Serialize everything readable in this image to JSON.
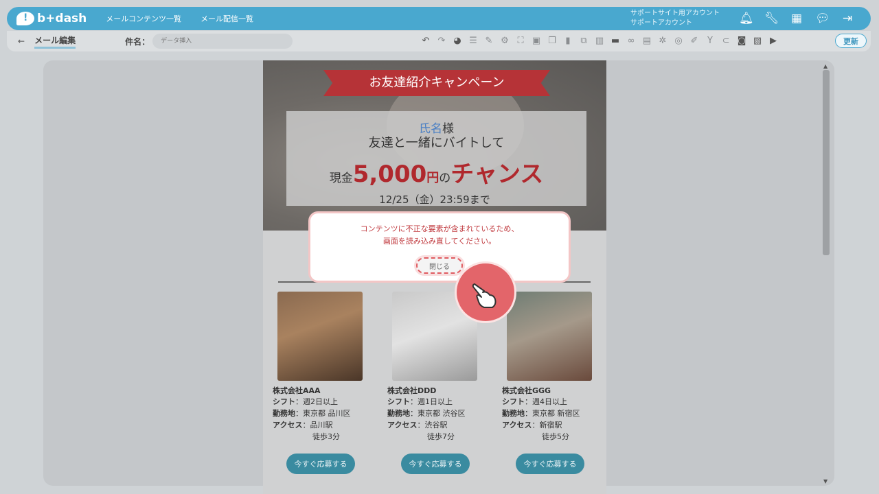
{
  "app": {
    "logo_text": "b+dash",
    "nav": [
      "メールコンテンツ一覧",
      "メール配信一覧"
    ],
    "account_line1": "サポートサイト用アカウント",
    "account_line2": "サポートアカウント",
    "top_icons": [
      "bell-icon",
      "wrench-icon",
      "apps-grid-icon",
      "chat-bubble-icon",
      "logout-icon"
    ]
  },
  "toolbar": {
    "back_icon": "←",
    "page_title": "メール編集",
    "subject_label": "件名：",
    "subject_placeholder": "データ挿入",
    "update_label": "更新",
    "tools": [
      "undo-icon",
      "redo-icon",
      "palette-icon",
      "align-icon",
      "pen-icon",
      "settings-icon",
      "expand-icon",
      "image-icon",
      "copy-icon",
      "trash-icon",
      "duplicate-icon",
      "columns-icon",
      "block-icon",
      "link-icon",
      "calendar-icon",
      "gears-icon",
      "database-icon",
      "edit-icon",
      "filter-icon",
      "link2-icon",
      "contact-icon",
      "preview-icon",
      "play-icon"
    ]
  },
  "mail": {
    "ribbon": "お友達紹介キャンペーン",
    "name_tag": "氏名",
    "name_suffix": "様",
    "line2": "友達と一緒にバイトして",
    "cash_prefix": "現金",
    "amount": "5,000",
    "yen": "円",
    "no": "の",
    "chance": "チャンス",
    "deadline": "12/25（金）23:59まで",
    "cards": [
      {
        "company": "株式会社AAA",
        "shift_label": "シフト",
        "shift": "：週2日以上",
        "place_label": "勤務地",
        "place": "：東京都 品川区",
        "access_label": "アクセス",
        "access": "：品川駅",
        "walk": "徒歩3分",
        "apply": "今すぐ応募する"
      },
      {
        "company": "株式会社DDD",
        "shift_label": "シフト",
        "shift": "：週1日以上",
        "place_label": "勤務地",
        "place": "：東京都 渋谷区",
        "access_label": "アクセス",
        "access": "：渋谷駅",
        "walk": "徒歩7分",
        "apply": "今すぐ応募する"
      },
      {
        "company": "株式会社GGG",
        "shift_label": "シフト",
        "shift": "：週4日以上",
        "place_label": "勤務地",
        "place": "：東京都 新宿区",
        "access_label": "アクセス",
        "access": "：新宿駅",
        "walk": "徒歩5分",
        "apply": "今すぐ応募する"
      }
    ]
  },
  "dialog": {
    "message_line1": "コンテンツに不正な要素が含まれているため、",
    "message_line2": "画面を読み込み直してください。",
    "close_label": "閉じる"
  },
  "colors": {
    "brand": "#49a8cf",
    "alert": "#c0393e",
    "accent_red": "#b0282d",
    "button": "#3a8ba0"
  }
}
